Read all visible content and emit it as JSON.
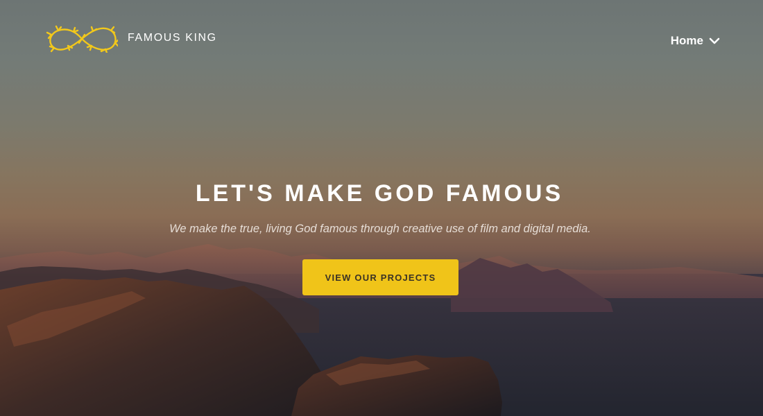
{
  "header": {
    "brand_name": "FAMOUS KING",
    "logo_icon": "infinity-thorns-logo",
    "nav": {
      "home_label": "Home",
      "chevron_icon": "chevron-down-icon"
    }
  },
  "hero": {
    "headline": "LET'S MAKE GOD FAMOUS",
    "tagline": "We make the true, living God famous through creative use of film and digital media.",
    "cta_label": "VIEW OUR PROJECTS"
  },
  "colors": {
    "accent": "#f0c419",
    "logo": "#f2c81b",
    "text": "#ffffff",
    "button_text": "#3a3225"
  }
}
